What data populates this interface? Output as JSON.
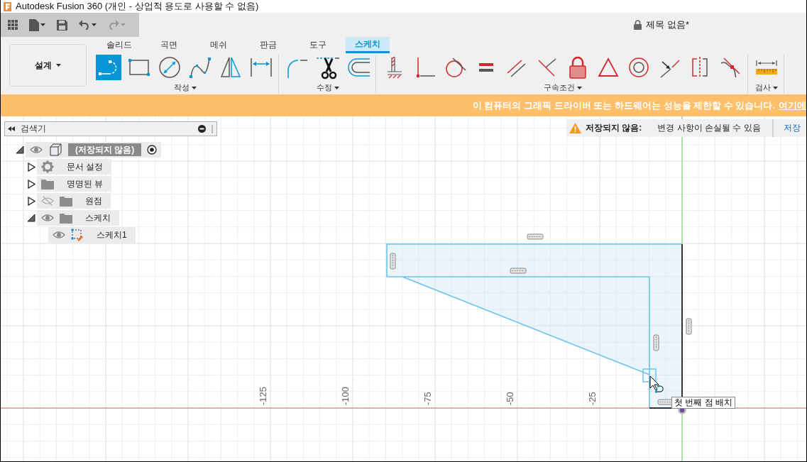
{
  "window": {
    "title": "Autodesk Fusion 360 (개인 - 상업적 용도로 사용할 수 없음)"
  },
  "quick_access": {
    "redo_disabled": true
  },
  "document": {
    "title": "제목 없음*"
  },
  "workspace": {
    "label": "설계"
  },
  "tabs": [
    {
      "label": "솔리드",
      "selected": false
    },
    {
      "label": "곡면",
      "selected": false
    },
    {
      "label": "메쉬",
      "selected": false
    },
    {
      "label": "판금",
      "selected": false
    },
    {
      "label": "도구",
      "selected": false
    },
    {
      "label": "스케치",
      "selected": true
    }
  ],
  "tool_groups": [
    {
      "label": "작성",
      "tools": [
        {
          "kind": "line",
          "selected": true
        },
        {
          "kind": "rectangle",
          "selected": false
        },
        {
          "kind": "circle",
          "selected": false
        },
        {
          "kind": "spline",
          "selected": false
        },
        {
          "kind": "mirror",
          "selected": false
        },
        {
          "kind": "dimension",
          "selected": false
        }
      ]
    },
    {
      "label": "수정",
      "tools": [
        {
          "kind": "fillet",
          "selected": false
        },
        {
          "kind": "trim",
          "selected": false
        },
        {
          "kind": "offset",
          "selected": false
        }
      ]
    },
    {
      "label": "구속조건",
      "tools": [
        {
          "kind": "horizontal",
          "selected": false
        },
        {
          "kind": "coincident",
          "selected": false
        },
        {
          "kind": "tangent",
          "selected": false
        },
        {
          "kind": "equal",
          "selected": false
        },
        {
          "kind": "parallel",
          "selected": false
        },
        {
          "kind": "perpendicular",
          "selected": false
        },
        {
          "kind": "fix",
          "selected": false
        },
        {
          "kind": "midpoint",
          "selected": false
        },
        {
          "kind": "concentric",
          "selected": false
        },
        {
          "kind": "collinear",
          "selected": false
        },
        {
          "kind": "symmetry",
          "selected": false
        },
        {
          "kind": "curvature",
          "selected": false
        }
      ]
    },
    {
      "label": "검사",
      "tools": [
        {
          "kind": "measure",
          "selected": false
        }
      ]
    }
  ],
  "banner": {
    "message": "이 컴퓨터의 그래픽 드라이버 또는 하드웨어는 성능을 제한할 수 있습니다.",
    "link": "여기에"
  },
  "browser": {
    "title": "검색기",
    "tree": [
      {
        "label": "(저장되지 않음)",
        "kind": "component",
        "visible": true,
        "expanded": true,
        "children": [
          {
            "label": "문서 설정",
            "kind": "settings",
            "expanded": false
          },
          {
            "label": "명명된 뷰",
            "kind": "folder",
            "expanded": false
          },
          {
            "label": "원점",
            "kind": "folder",
            "visible": false,
            "expanded": false
          },
          {
            "label": "스케치",
            "kind": "folder",
            "visible": true,
            "expanded": true,
            "children": [
              {
                "label": "스케치1",
                "kind": "sketch",
                "visible": true
              }
            ]
          }
        ]
      }
    ]
  },
  "save_notice": {
    "title": "저장되지 않음:",
    "message": "변경 사항이 손실될 수 있음",
    "action": "저장"
  },
  "canvas": {
    "axis_labels": [
      "-125",
      "-100",
      "-75",
      "-50",
      "-25"
    ],
    "tooltip": "첫 번째 점 배치"
  }
}
